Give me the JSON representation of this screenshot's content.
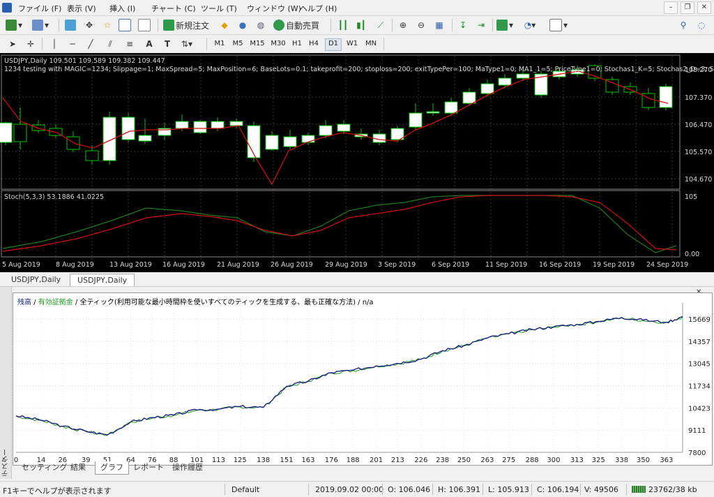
{
  "menubar": {
    "items": [
      "ファイル (F)",
      "表示 (V)",
      "挿入 (I)",
      "チャート (C)",
      "ツール (T)",
      "ウィンドウ (W)",
      "ヘルプ (H)"
    ]
  },
  "toolbar": {
    "new_order_label": "新規注文",
    "auto_trade_label": "自動売買",
    "timeframes": [
      "M1",
      "M5",
      "M15",
      "M30",
      "H1",
      "H4",
      "D1",
      "W1",
      "MN"
    ],
    "active_timeframe": "D1"
  },
  "chart": {
    "symbol_line": "USDJPY,Daily  109.501 109.589 109.382 109.447",
    "ea_params": "1234 testing with MAGIC=1234; Slippage=1; MaxSpread=5; MaxPosition=6; BaseLots=0.1; takeprofit=200; stoploss=200; exitTypePer=100; MaType1=0; MA1_1=5; PriceType1=0; Stochas1_K=5; Stochas2_D=3; Stoch",
    "indicator_label": "Stoch(5,3,3) 53.1886 41.0225",
    "price_ticks": [
      "108.270",
      "107.370",
      "106.470",
      "105.570",
      "104.670"
    ],
    "stoch_ticks": [
      "105",
      "0.00"
    ],
    "date_ticks": [
      "5 Aug 2019",
      "8 Aug 2019",
      "13 Aug 2019",
      "16 Aug 2019",
      "21 Aug 2019",
      "26 Aug 2019",
      "29 Aug 2019",
      "3 Sep 2019",
      "6 Sep 2019",
      "11 Sep 2019",
      "16 Sep 2019",
      "19 Sep 2019",
      "24 Sep 2019"
    ],
    "colors": {
      "bull": "#ffffff",
      "bear": "#000000",
      "wick": "#00c800",
      "ma": "#cc1010",
      "stoch_main": "#1f7a1f",
      "stoch_signal": "#cc1010"
    }
  },
  "chart_tabs": [
    "USDJPY,Daily",
    "USDJPY,Daily"
  ],
  "tester": {
    "side_label": "テスター",
    "legend": {
      "balance": "残高",
      "sep1": " / ",
      "equity": "有効証拠金",
      "sep2": " / ",
      "model": "全ティック(利用可能な最小時間枠を使いすべてのティックを生成する、最も正確な方法) / n/a"
    },
    "tabs": [
      "セッティング",
      "結果",
      "グラフ",
      "レポート",
      "操作履歴"
    ],
    "active_tab": "グラフ"
  },
  "chart_data": {
    "type": "line",
    "x": [
      0,
      14,
      26,
      39,
      51,
      64,
      76,
      88,
      101,
      113,
      125,
      138,
      151,
      163,
      176,
      188,
      201,
      213,
      226,
      238,
      250,
      263,
      275,
      288,
      300,
      313,
      325,
      338,
      350,
      363,
      372
    ],
    "series": [
      {
        "name": "残高",
        "values": [
          9950,
          9700,
          9350,
          9050,
          8830,
          9600,
          9850,
          10000,
          10300,
          10350,
          10500,
          10450,
          11700,
          12000,
          12500,
          12650,
          12900,
          13050,
          13300,
          13800,
          14100,
          14550,
          14800,
          15050,
          15200,
          15350,
          15520,
          15750,
          15600,
          15480,
          15800
        ]
      },
      {
        "name": "有効証拠金",
        "values": [
          9930,
          9680,
          9330,
          9020,
          8800,
          9580,
          9820,
          9980,
          10280,
          10330,
          10480,
          10430,
          11650,
          11980,
          12480,
          12620,
          12880,
          13020,
          13280,
          13780,
          14080,
          14520,
          14780,
          15030,
          15180,
          15330,
          15500,
          15730,
          15580,
          15450,
          15780
        ]
      }
    ],
    "x_ticks": [
      "0",
      "14",
      "26",
      "39",
      "51",
      "64",
      "76",
      "88",
      "101",
      "113",
      "125",
      "138",
      "151",
      "163",
      "176",
      "188",
      "201",
      "213",
      "226",
      "238",
      "250",
      "263",
      "275",
      "288",
      "300",
      "313",
      "325",
      "338",
      "350",
      "363"
    ],
    "y_ticks": [
      "15669",
      "14357",
      "13045",
      "11734",
      "10423",
      "9111",
      "7800"
    ],
    "ylim": [
      7800,
      16200
    ],
    "colors": {
      "balance": "#1a237e",
      "equity": "#1a9a1a"
    }
  },
  "statusbar": {
    "help": "F1キーでヘルプが表示されます",
    "profile": "Default",
    "datetime": "2019.09.02 00:00",
    "open": "O: 106.046",
    "high": "H: 106.391",
    "low": "L: 105.913",
    "close": "C: 106.194",
    "volume": "V: 49506",
    "traffic": "23762/38 kb"
  }
}
